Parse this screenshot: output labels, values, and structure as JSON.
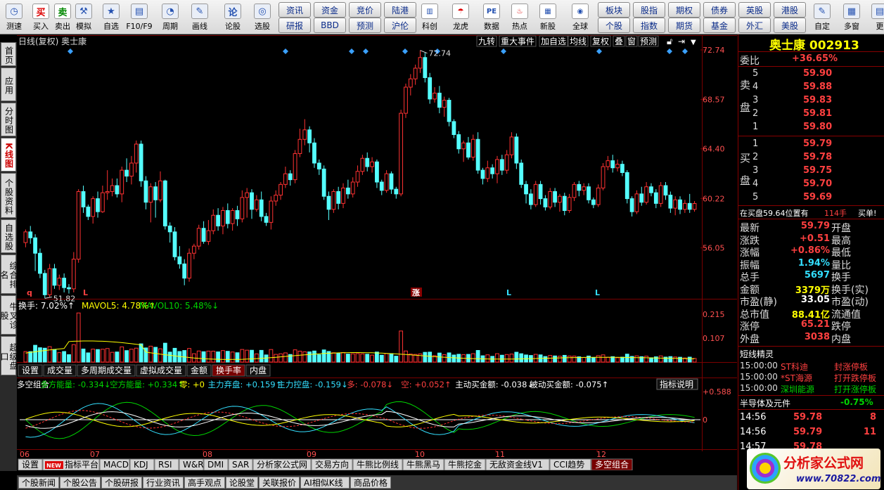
{
  "toolbar": {
    "left": [
      {
        "label": "测速",
        "icon": "clock-icon"
      },
      {
        "label": "买入",
        "icon": "buy-icon",
        "glyph": "买"
      },
      {
        "label": "卖出",
        "icon": "sell-icon",
        "glyph": "卖"
      },
      {
        "label": "模拟",
        "icon": "hammer-icon"
      },
      {
        "label": "自选",
        "icon": "star-icon"
      },
      {
        "label": "F10/F9",
        "icon": "f10-icon"
      },
      {
        "label": "周期",
        "icon": "period-icon"
      },
      {
        "label": "画线",
        "icon": "pen-icon"
      },
      {
        "label": "论股",
        "icon": "discuss-icon",
        "glyph": "论"
      },
      {
        "label": "选股",
        "icon": "select-stock-icon"
      }
    ],
    "grid1": [
      [
        "资讯",
        "资金",
        "竞价",
        "陆港"
      ],
      [
        "研报",
        "BBD",
        "预测",
        "沪伦"
      ]
    ],
    "middle": [
      {
        "label": "科创",
        "icon": "sci-tech-icon"
      },
      {
        "label": "龙虎",
        "icon": "dragon-tiger-icon"
      },
      {
        "label": "数据",
        "icon": "pe-data-icon",
        "glyph": "PE"
      },
      {
        "label": "热点",
        "icon": "hot-icon"
      },
      {
        "label": "新股",
        "icon": "new-stock-icon"
      },
      {
        "label": "全球",
        "icon": "globe-icon"
      }
    ],
    "grid2": [
      [
        "板块",
        "股指",
        "期权",
        "债券",
        "英股",
        "港股"
      ],
      [
        "个股",
        "指数",
        "期货",
        "基金",
        "外汇",
        "美股"
      ]
    ],
    "right": [
      {
        "label": "自定",
        "icon": "custom-icon"
      },
      {
        "label": "多窗",
        "icon": "multi-window-icon"
      },
      {
        "label": "更",
        "icon": "more-icon"
      }
    ]
  },
  "lefttabs": [
    {
      "label": "首页",
      "active": false
    },
    {
      "label": "应用",
      "active": false
    },
    {
      "label": "分时图",
      "active": false
    },
    {
      "label": "K线图",
      "active": true
    },
    {
      "label": "个股资料",
      "active": false
    },
    {
      "label": "自选股",
      "active": false
    },
    {
      "label": "综合排名",
      "active": false
    },
    {
      "label": "牛叉诊股",
      "active": false
    },
    {
      "label": "超级盘口",
      "active": false
    }
  ],
  "chart": {
    "header_left": "日线(复权) 奥士康",
    "buttons": [
      "九转",
      "重大事件",
      "加自选",
      "均线",
      "复权",
      "叠",
      "窗",
      "预测"
    ],
    "price_axis": [
      "72.74",
      "68.57",
      "64.40",
      "60.22",
      "56.05"
    ],
    "max_label": "72.74",
    "min_label": "51.82",
    "markers": [
      "q",
      "L",
      "涨",
      "L",
      "L"
    ],
    "vol_header": {
      "a": "换手: 7.02%↑",
      "b": "MAVOL5: 4.78%↑",
      "c": "MAVOL10: 5.48%↓"
    },
    "vol_axis": [
      "0.215",
      "0.107"
    ],
    "vol_tabs": [
      "设置",
      "成交量",
      "多周期成交量",
      "虚拟成交量",
      "金额",
      "换手率",
      "内盘"
    ],
    "vol_tab_active": "换手率",
    "ind_header": [
      {
        "t": "多空组合",
        "c": "w"
      },
      {
        "t": "多方能量: -0.334↓",
        "c": "g"
      },
      {
        "t": "空方能量: +0.334↑",
        "c": "g"
      },
      {
        "t": "零: +0",
        "c": "y"
      },
      {
        "t": "主力弃盘: +0.159↑",
        "c": "c"
      },
      {
        "t": "主力控盘: -0.159↓",
        "c": "c"
      },
      {
        "t": "多: -0.078↓",
        "c": "r"
      },
      {
        "t": "空: +0.052↑",
        "c": "r"
      },
      {
        "t": "主动买金额: -0.038↓",
        "c": "w"
      },
      {
        "t": "被动买金额: -0.075↑",
        "c": "w"
      }
    ],
    "ind_button": "指标说明",
    "ind_axis": [
      "+0.588",
      "0"
    ],
    "months": [
      "06",
      "07",
      "08",
      "09",
      "10",
      "11",
      "12"
    ],
    "bottom_tabs": [
      "设置",
      "指标平台",
      "MACD",
      "KDJ",
      "RSI",
      "W&R",
      "DMI",
      "SAR",
      "分析家公式网",
      "交易方向",
      "牛熊比例线",
      "牛熊黑马",
      "牛熊挖金",
      "无敌资金线V1",
      "CCI趋势",
      "多空组合"
    ],
    "bottom_tab_active": "多空组合",
    "new_badge": "NEW",
    "bottom_row2": [
      "个股新闻",
      "个股公告",
      "个股研报",
      "行业资讯",
      "高手观点",
      "论股堂",
      "关联报价",
      "AI相似K线",
      "商品价格"
    ]
  },
  "chart_data": {
    "type": "candlestick",
    "title": "日线(复权) 奥士康",
    "ylim": [
      51.82,
      72.74
    ],
    "xlabels": [
      "06",
      "07",
      "08",
      "09",
      "10",
      "11",
      "12"
    ],
    "candles": [
      [
        56.5,
        57.4,
        57.6,
        56.1
      ],
      [
        57.4,
        56.9,
        57.9,
        56.4
      ],
      [
        56.9,
        55.6,
        57.2,
        54.1
      ],
      [
        55.6,
        53.9,
        56.0,
        53.5
      ],
      [
        53.9,
        52.1,
        54.2,
        51.8
      ],
      [
        52.1,
        54.3,
        54.7,
        51.9
      ],
      [
        54.3,
        52.9,
        54.7,
        52.6
      ],
      [
        52.9,
        53.5,
        53.8,
        52.5
      ],
      [
        53.5,
        52.7,
        53.9,
        52.3
      ],
      [
        52.7,
        52.6,
        53.0,
        52.2
      ],
      [
        52.6,
        55.1,
        55.7,
        52.3
      ],
      [
        55.1,
        60.8,
        61.0,
        54.8
      ],
      [
        60.8,
        59.5,
        61.3,
        59.0
      ],
      [
        59.5,
        58.7,
        59.7,
        58.4
      ],
      [
        58.7,
        60.2,
        60.4,
        58.1
      ],
      [
        60.2,
        59.1,
        60.8,
        58.6
      ],
      [
        59.1,
        60.7,
        61.3,
        59.0
      ],
      [
        60.7,
        60.8,
        62.6,
        60.1
      ],
      [
        60.8,
        61.3,
        61.9,
        60.4
      ],
      [
        61.3,
        60.6,
        61.9,
        60.3
      ],
      [
        60.6,
        62.6,
        62.9,
        59.9
      ],
      [
        62.6,
        62.1,
        63.6,
        61.6
      ],
      [
        62.1,
        63.2,
        63.8,
        61.4
      ],
      [
        63.2,
        64.8,
        65.1,
        62.4
      ],
      [
        64.8,
        61.7,
        65.1,
        61.2
      ],
      [
        61.7,
        59.9,
        62.1,
        59.3
      ],
      [
        59.9,
        61.2,
        61.5,
        58.2
      ],
      [
        61.2,
        60.1,
        61.6,
        58.6
      ],
      [
        60.1,
        61.7,
        62.5,
        59.9
      ],
      [
        61.7,
        57.9,
        61.8,
        57.6
      ],
      [
        57.9,
        57.4,
        58.2,
        56.5
      ],
      [
        57.4,
        55.3,
        57.8,
        55.0
      ],
      [
        55.3,
        54.7,
        56.2,
        54.3
      ],
      [
        54.7,
        53.5,
        55.1,
        52.9
      ],
      [
        53.5,
        55.6,
        56.0,
        53.2
      ],
      [
        55.6,
        56.2,
        56.4,
        55.1
      ],
      [
        56.2,
        57.7,
        58.0,
        55.9
      ],
      [
        57.7,
        56.6,
        58.3,
        56.4
      ],
      [
        56.6,
        57.5,
        58.4,
        56.3
      ],
      [
        57.5,
        58.8,
        59.3,
        57.2
      ],
      [
        58.8,
        57.9,
        59.4,
        57.5
      ],
      [
        57.9,
        59.2,
        59.5,
        57.2
      ],
      [
        59.2,
        58.1,
        59.8,
        57.7
      ],
      [
        58.1,
        59.2,
        59.4,
        57.5
      ],
      [
        59.2,
        58.5,
        59.6,
        57.9
      ],
      [
        58.5,
        60.3,
        60.9,
        58.2
      ],
      [
        60.3,
        60.7,
        61.1,
        58.6
      ],
      [
        60.7,
        59.3,
        61.0,
        58.5
      ],
      [
        59.3,
        60.1,
        60.5,
        59.1
      ],
      [
        60.1,
        58.7,
        60.8,
        58.3
      ],
      [
        58.7,
        58.2,
        59.0,
        57.9
      ],
      [
        58.2,
        60.0,
        60.4,
        57.6
      ],
      [
        60.0,
        60.5,
        60.9,
        59.6
      ],
      [
        60.5,
        61.4,
        61.6,
        60.1
      ],
      [
        61.4,
        62.3,
        62.9,
        61.1
      ],
      [
        62.3,
        61.8,
        62.6,
        61.3
      ],
      [
        61.8,
        64.0,
        64.3,
        61.5
      ],
      [
        64.0,
        65.2,
        66.1,
        63.7
      ],
      [
        65.2,
        66.0,
        66.9,
        64.7
      ],
      [
        66.0,
        64.9,
        66.3,
        64.1
      ],
      [
        64.9,
        63.2,
        65.3,
        62.8
      ],
      [
        63.2,
        62.7,
        63.5,
        62.2
      ],
      [
        62.7,
        60.4,
        63.0,
        60.1
      ],
      [
        60.4,
        59.3,
        60.8,
        58.4
      ],
      [
        59.3,
        60.8,
        61.0,
        59.0
      ],
      [
        60.8,
        59.8,
        61.2,
        59.3
      ],
      [
        59.8,
        61.1,
        61.5,
        59.4
      ],
      [
        61.1,
        60.6,
        61.8,
        60.2
      ],
      [
        60.6,
        61.6,
        62.0,
        60.3
      ],
      [
        61.6,
        62.5,
        63.0,
        61.2
      ],
      [
        62.5,
        63.6,
        63.9,
        62.2
      ],
      [
        63.6,
        62.9,
        64.1,
        62.5
      ],
      [
        62.9,
        63.3,
        63.7,
        62.4
      ],
      [
        63.3,
        61.6,
        63.5,
        61.1
      ],
      [
        61.6,
        60.9,
        61.8,
        60.5
      ],
      [
        60.9,
        62.3,
        62.6,
        60.7
      ],
      [
        62.3,
        61.0,
        62.5,
        60.6
      ],
      [
        61.0,
        60.6,
        61.2,
        60.2
      ],
      [
        60.6,
        67.4,
        67.7,
        60.4
      ],
      [
        67.4,
        69.6,
        69.9,
        67.0
      ],
      [
        69.6,
        70.3,
        70.7,
        68.9
      ],
      [
        70.3,
        71.2,
        71.5,
        69.8
      ],
      [
        71.2,
        72.1,
        72.7,
        70.8
      ],
      [
        72.1,
        70.4,
        72.5,
        70.0
      ],
      [
        70.4,
        68.6,
        70.8,
        68.2
      ],
      [
        68.6,
        69.1,
        69.6,
        68.3
      ],
      [
        69.1,
        67.9,
        69.7,
        67.4
      ],
      [
        67.9,
        68.5,
        68.8,
        67.1
      ],
      [
        68.5,
        66.7,
        68.7,
        66.3
      ],
      [
        66.7,
        65.6,
        66.9,
        65.3
      ],
      [
        65.6,
        64.4,
        65.9,
        64.0
      ],
      [
        64.4,
        64.9,
        65.1,
        63.3
      ],
      [
        64.9,
        63.7,
        65.4,
        63.5
      ],
      [
        63.7,
        65.2,
        65.6,
        63.4
      ],
      [
        65.2,
        62.6,
        65.8,
        62.3
      ],
      [
        62.6,
        61.9,
        62.8,
        61.4
      ],
      [
        61.9,
        62.8,
        63.4,
        61.6
      ],
      [
        62.8,
        62.3,
        63.1,
        61.9
      ],
      [
        62.3,
        63.5,
        63.8,
        61.5
      ],
      [
        63.5,
        62.6,
        63.9,
        62.2
      ],
      [
        62.6,
        63.9,
        64.3,
        62.3
      ],
      [
        63.9,
        65.4,
        65.8,
        63.6
      ],
      [
        65.4,
        63.2,
        65.7,
        62.7
      ],
      [
        63.2,
        61.4,
        63.5,
        61.1
      ],
      [
        61.4,
        60.6,
        61.7,
        59.8
      ],
      [
        60.6,
        59.7,
        61.0,
        59.3
      ],
      [
        59.7,
        61.4,
        61.7,
        59.5
      ],
      [
        61.4,
        60.2,
        61.7,
        59.7
      ],
      [
        60.2,
        59.5,
        60.5,
        59.2
      ],
      [
        59.5,
        60.8,
        61.1,
        59.3
      ],
      [
        60.8,
        59.9,
        61.1,
        59.5
      ],
      [
        59.9,
        60.4,
        60.6,
        59.1
      ],
      [
        60.4,
        59.2,
        60.7,
        58.8
      ],
      [
        59.2,
        60.3,
        60.6,
        59.0
      ],
      [
        60.3,
        61.4,
        61.6,
        60.0
      ],
      [
        61.4,
        60.9,
        61.7,
        60.4
      ],
      [
        60.9,
        61.2,
        61.5,
        60.5
      ],
      [
        61.2,
        60.1,
        61.5,
        59.8
      ],
      [
        60.1,
        59.7,
        60.3,
        59.4
      ],
      [
        59.7,
        61.1,
        61.4,
        59.5
      ],
      [
        61.1,
        62.9,
        63.2,
        60.9
      ],
      [
        62.9,
        63.4,
        63.8,
        62.6
      ],
      [
        63.4,
        62.8,
        63.9,
        62.4
      ],
      [
        62.8,
        63.1,
        63.5,
        62.5
      ],
      [
        63.1,
        62.4,
        63.4,
        62.1
      ],
      [
        62.4,
        60.2,
        62.6,
        59.8
      ],
      [
        60.2,
        59.1,
        60.4,
        58.7
      ],
      [
        59.1,
        60.6,
        60.9,
        58.9
      ],
      [
        60.6,
        59.9,
        61.2,
        59.6
      ],
      [
        59.9,
        61.2,
        61.6,
        59.7
      ],
      [
        61.2,
        60.7,
        61.5,
        60.4
      ],
      [
        60.7,
        59.8,
        61.0,
        59.4
      ],
      [
        59.8,
        61.3,
        61.6,
        59.5
      ],
      [
        61.3,
        60.5,
        61.6,
        60.1
      ],
      [
        60.5,
        59.4,
        60.8,
        59.0
      ],
      [
        59.4,
        60.1,
        60.4,
        58.8
      ],
      [
        60.1,
        59.3,
        60.4,
        58.9
      ],
      [
        59.3,
        59.8,
        60.1,
        59.0
      ],
      [
        59.8,
        59.3,
        60.6,
        59.0
      ],
      [
        59.3,
        59.79,
        60.0,
        59.1
      ]
    ],
    "volume_ticks": [
      0.215,
      0.107
    ]
  },
  "quote": {
    "name_code": "奥士康 002913",
    "weibi_label": "委比",
    "weibi": "+36.65%",
    "sell_label": "卖盘",
    "buy_label": "买盘",
    "asks": [
      [
        "5",
        "59.90",
        ""
      ],
      [
        "4",
        "59.88",
        ""
      ],
      [
        "3",
        "59.83",
        ""
      ],
      [
        "2",
        "59.81",
        ""
      ],
      [
        "1",
        "59.80",
        ""
      ]
    ],
    "bids": [
      [
        "1",
        "59.79",
        ""
      ],
      [
        "2",
        "59.78",
        ""
      ],
      [
        "3",
        "59.75",
        ""
      ],
      [
        "4",
        "59.70",
        ""
      ],
      [
        "5",
        "59.69",
        ""
      ]
    ],
    "status_left": "在买盘59.64位置有",
    "status_num": "114手",
    "status_right": "买单!",
    "stats": [
      {
        "l": "最新",
        "v": "59.79",
        "l2": "开盘",
        "c": "r"
      },
      {
        "l": "涨跌",
        "v": "+0.51",
        "l2": "最高",
        "c": "r"
      },
      {
        "l": "涨幅",
        "v": "+0.86%",
        "l2": "最低",
        "c": "r"
      },
      {
        "l": "振幅",
        "v": "1.94%",
        "l2": "量比",
        "c": "c"
      },
      {
        "l": "总手",
        "v": "5697",
        "l2": "换手",
        "c": "c"
      },
      {
        "l": "金额",
        "v": "3379万",
        "l2": "换手(实)",
        "c": "y"
      },
      {
        "l": "市盈(静)",
        "v": "33.05",
        "l2": "市盈(动)",
        "c": "w"
      },
      {
        "l": "总市值",
        "v": "88.41亿",
        "l2": "流通值",
        "c": "y"
      },
      {
        "l": "涨停",
        "v": "65.21",
        "l2": "跌停",
        "c": "r"
      },
      {
        "l": "外盘",
        "v": "3038",
        "l2": "内盘",
        "c": "r"
      }
    ],
    "news_title": "短线精灵",
    "news": [
      {
        "t": "15:00:00",
        "n": "ST科迪",
        "e": "封涨停板"
      },
      {
        "t": "15:00:00",
        "n": "*ST海源",
        "e": "打开跌停板"
      },
      {
        "t": "15:00:00",
        "n": "深圳能源",
        "e": "打开涨停板"
      }
    ],
    "sector": "半导体及元件",
    "sector_chg": "-0.75%",
    "ticks": [
      [
        "14:56",
        "59.78",
        "8"
      ],
      [
        "14:56",
        "59.79",
        "11"
      ],
      [
        "14:57",
        "59.78",
        ""
      ]
    ]
  },
  "watermark": {
    "text": "分析家公式网",
    "url": "www.70822.com"
  },
  "colors": {
    "up": "#ff3232",
    "down": "#54ffff",
    "grid": "#7a0000",
    "accent": "#ffff00"
  }
}
